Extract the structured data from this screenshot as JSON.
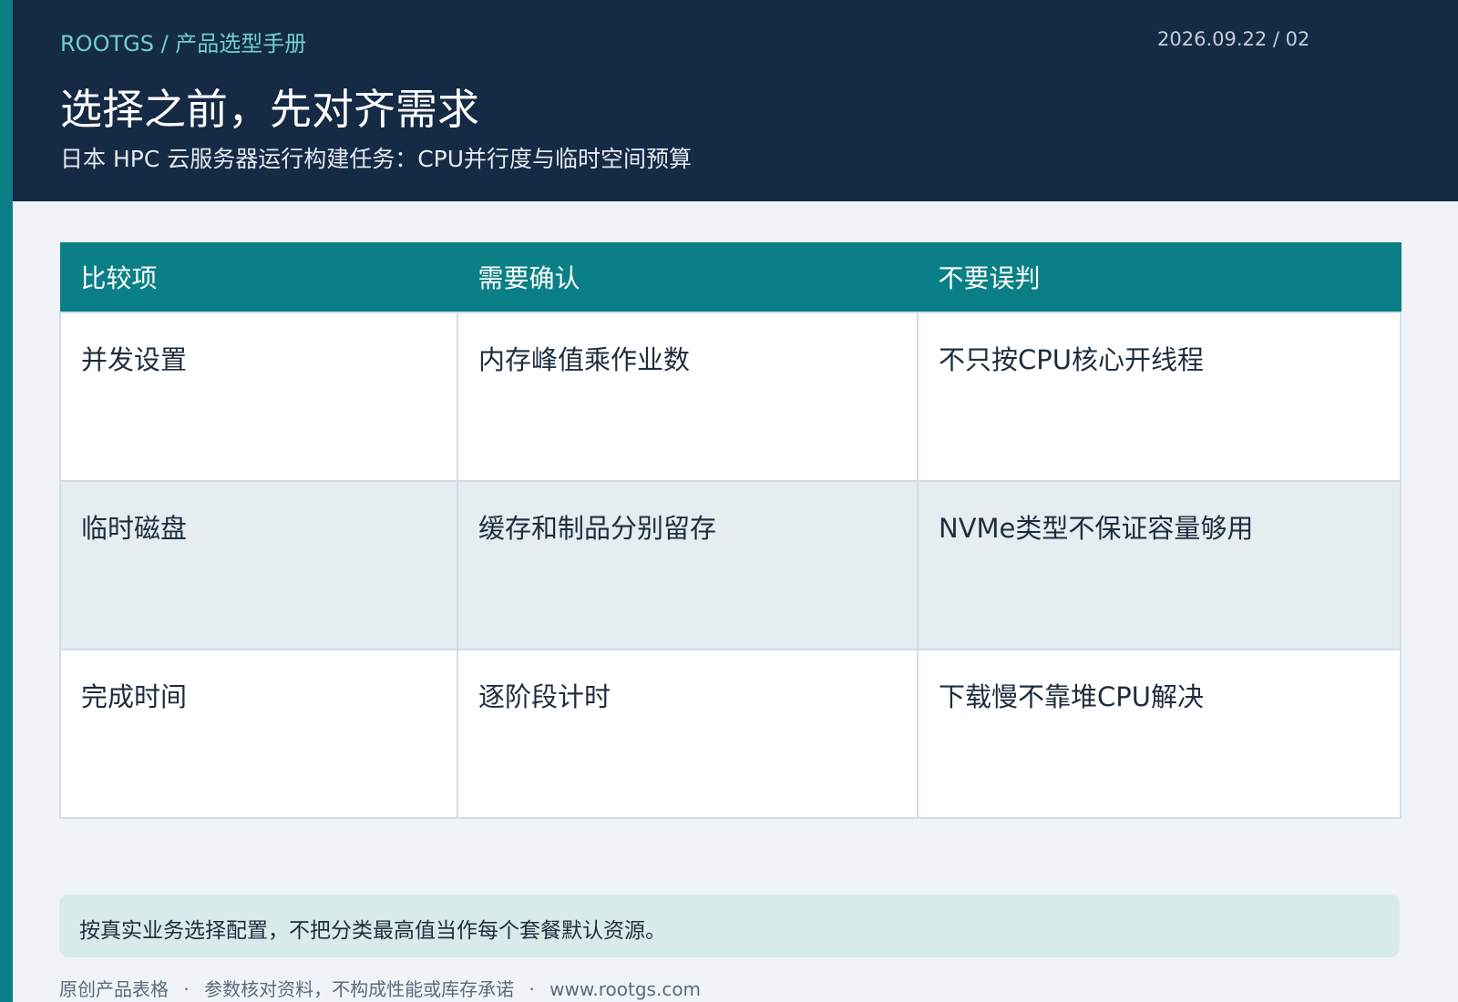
{
  "header": {
    "breadcrumb": "ROOTGS / 产品选型手册",
    "date_page": "2026.09.22 / 02",
    "title": "选择之前，先对齐需求",
    "subtitle": "日本 HPC 云服务器运行构建任务：CPU并行度与临时空间预算"
  },
  "table": {
    "headers": [
      "比较项",
      "需要确认",
      "不要误判"
    ],
    "rows": [
      [
        "并发设置",
        "内存峰值乘作业数",
        "不只按CPU核心开线程"
      ],
      [
        "临时磁盘",
        "缓存和制品分别留存",
        "NVMe类型不保证容量够用"
      ],
      [
        "完成时间",
        "逐阶段计时",
        "下载慢不靠堆CPU解决"
      ]
    ]
  },
  "note": "按真实业务选择配置，不把分类最高值当作每个套餐默认资源。",
  "footer": {
    "items": [
      "原创产品表格",
      "参数核对资料，不构成性能或库存承诺",
      "www.rootgs.com"
    ],
    "separator": "·"
  },
  "colors": {
    "header_bg": "#152a44",
    "accent_teal": "#0b7f86",
    "breadcrumb": "#6fd0c9",
    "page_bg": "#f0f4f8",
    "note_bg": "#d8ebeb"
  }
}
